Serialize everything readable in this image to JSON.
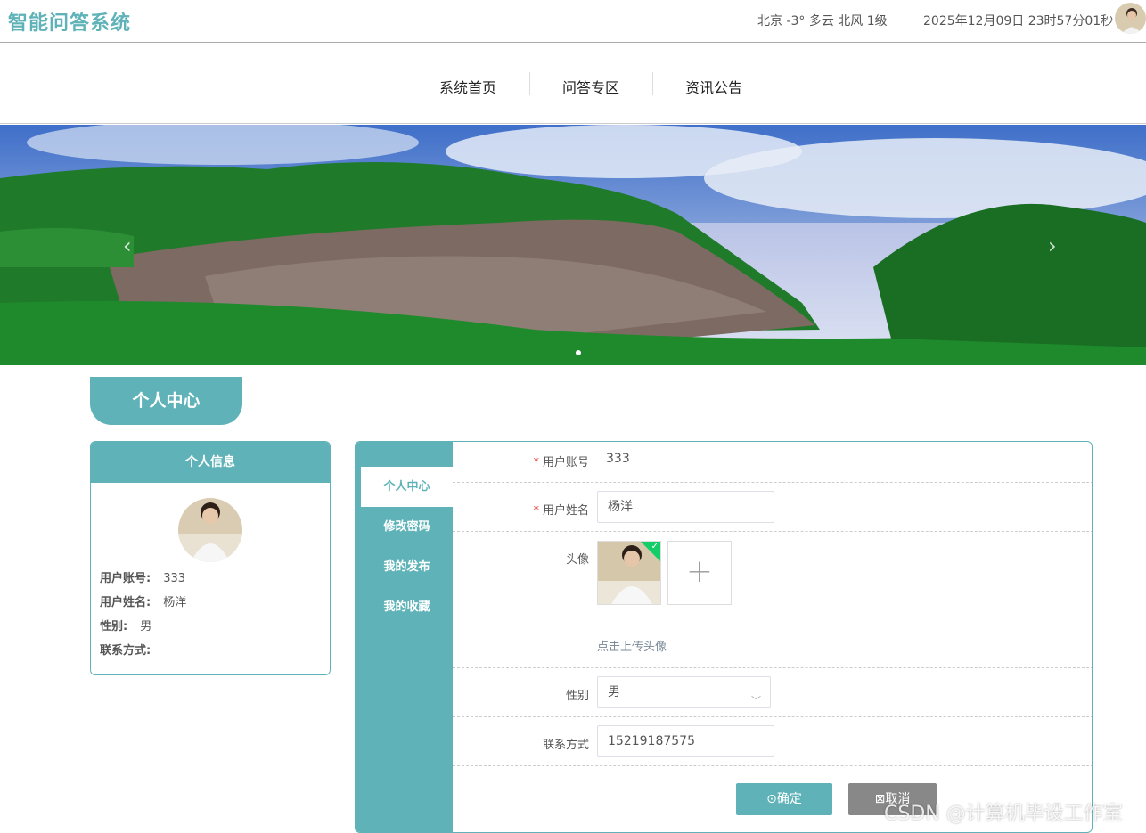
{
  "header": {
    "logo": "智能问答系统",
    "weather": "北京  -3°  多云  北风  1级",
    "datetime": "2025年12月09日 23时57分01秒"
  },
  "nav": {
    "items": [
      {
        "label": "系统首页"
      },
      {
        "label": "问答专区"
      },
      {
        "label": "资讯公告"
      }
    ]
  },
  "banner": {
    "prev_icon": "‹",
    "next_icon": "›"
  },
  "page_title": "个人中心",
  "info_card": {
    "title": "个人信息",
    "rows": [
      {
        "label": "用户账号:",
        "value": "333"
      },
      {
        "label": "用户姓名:",
        "value": "杨洋"
      },
      {
        "label": "性别:",
        "value": "男"
      },
      {
        "label": "联系方式:",
        "value": ""
      }
    ]
  },
  "sidebar": {
    "items": [
      {
        "label": "个人中心"
      },
      {
        "label": "修改密码"
      },
      {
        "label": "我的发布"
      },
      {
        "label": "我的收藏"
      }
    ]
  },
  "form": {
    "account_label": "用户账号",
    "account_value": "333",
    "name_label": "用户姓名",
    "name_value": "杨洋",
    "avatar_label": "头像",
    "upload_tip": "点击上传头像",
    "gender_label": "性别",
    "gender_value": "男",
    "phone_label": "联系方式",
    "phone_value": "15219187575",
    "ok_label": "⊙确定",
    "cancel_label": "⊠取消"
  },
  "watermark": "CSDN @计算机毕设工作室",
  "colors": {
    "accent": "#5fb3b8",
    "success": "#13ce66",
    "cancel": "#888888"
  }
}
